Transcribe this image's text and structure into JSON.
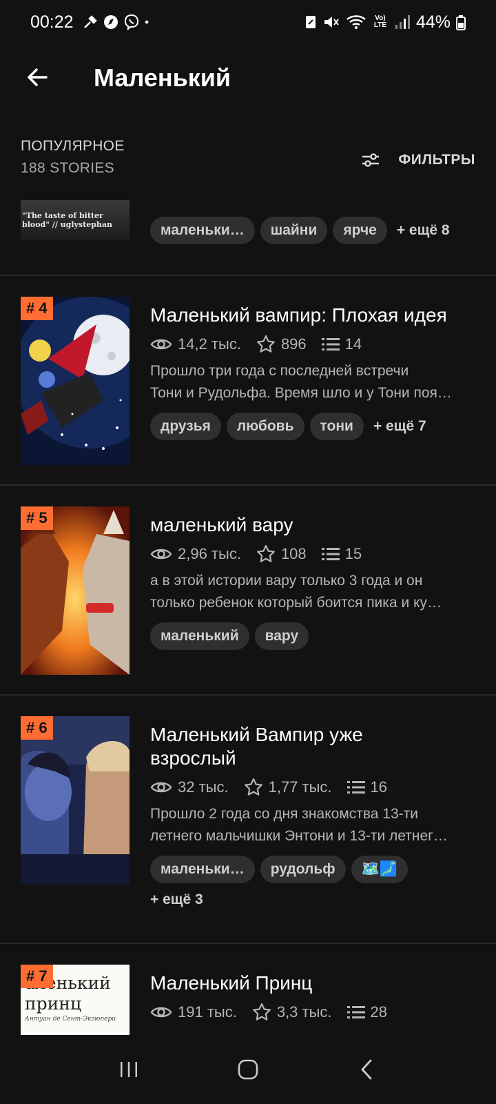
{
  "status_bar": {
    "time": "00:22",
    "battery": "44%",
    "left_icons": [
      "tools-icon",
      "compass-icon",
      "viber-icon",
      "dot-icon"
    ],
    "right_icons": [
      "nfc-icon",
      "mute-icon",
      "wifi-icon",
      "volte-icon",
      "signal-icon",
      "battery-icon"
    ],
    "lte_label": "Vo) LTE"
  },
  "app_bar": {
    "title": "Маленький",
    "back_icon": "arrow-left-icon"
  },
  "section": {
    "title": "ПОПУЛЯРНОЕ",
    "count": "188 STORIES",
    "filters_label": "ФИЛЬТРЫ",
    "filters_icon": "sliders-icon"
  },
  "partial_story": {
    "cover_text": "\"The taste of bitter blood\" // uglystephan",
    "tags": [
      "маленьки…",
      "шайни",
      "ярче"
    ],
    "more": "+ ещё 8"
  },
  "stories": [
    {
      "rank": "# 4",
      "title": "Маленький вампир: Плохая идея",
      "reads": "14,2 тыс.",
      "votes": "896",
      "parts": "14",
      "desc": [
        "Прошло три года с последней встречи",
        "Тони и Рудольфа. Время шло и у Тони поя…"
      ],
      "tags": [
        "друзья",
        "любовь",
        "тони"
      ],
      "more": "+ ещё 7"
    },
    {
      "rank": "# 5",
      "title": "маленький вару",
      "reads": "2,96 тыс.",
      "votes": "108",
      "parts": "15",
      "desc": [
        "а в этой истории вару только 3 года и он",
        "только ребенок который боится пика и ку…"
      ],
      "tags": [
        "маленький",
        "вару"
      ],
      "more": ""
    },
    {
      "rank": "# 6",
      "title": "Маленький Вампир уже взрослый",
      "reads": "32 тыс.",
      "votes": "1,77 тыс.",
      "parts": "16",
      "desc": [
        "Прошло 2 года со дня знакомства 13-ти",
        "летнего мальчишки Энтони и 13-ти летнег…"
      ],
      "tags": [
        "маленьки…",
        "рудольф",
        "🗺️🗾"
      ],
      "more": "+ ещё 3"
    },
    {
      "rank": "# 7",
      "title": "Маленький Принц",
      "reads": "191 тыс.",
      "votes": "3,3 тыс.",
      "parts": "28",
      "cover_title": "аленький принц",
      "cover_author": "Антуан де Сент-Экзюпери"
    }
  ],
  "nav_bar": {
    "icons": [
      "recent-apps-icon",
      "home-icon",
      "back-icon"
    ]
  },
  "colors": {
    "background": "#121212",
    "rank_badge": "#ff6d33",
    "tag_bg": "#2f2f2f",
    "muted_text": "#b5b5b5"
  }
}
